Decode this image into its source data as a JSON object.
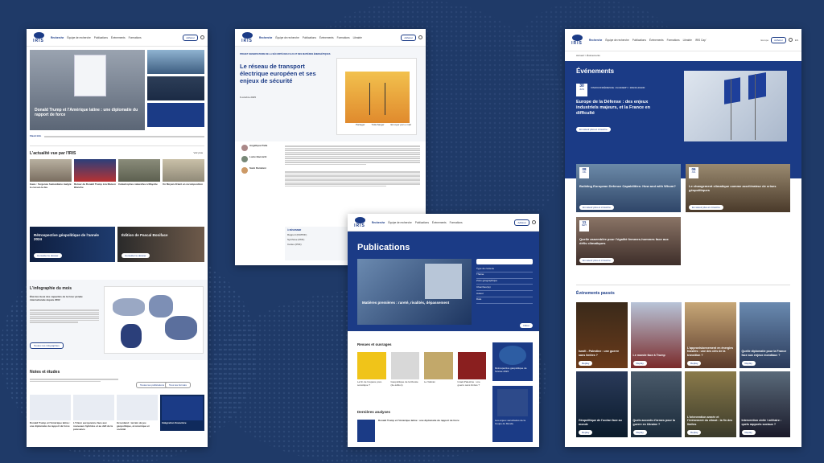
{
  "colors": {
    "background": "#1f3a68",
    "navy": "#1b3b86",
    "dark_card": "#0f2a5c"
  },
  "logo": "IRIS",
  "nav": {
    "recherche": "Recherche",
    "equipe": "Équipe de recherche",
    "publications": "Publications",
    "evenements": "Événements",
    "formations": "Formations",
    "librairie": "Librairie",
    "iris_cap": "IRIS Cap'"
  },
  "util": {
    "europe": "Europe",
    "recrutement": "Recrutement",
    "locations": "Locations",
    "contact": "Contact",
    "adherer": "Adhérer",
    "lang": "EN"
  },
  "home": {
    "hero_title": "Donald Trump et l'Amérique latine : une diplomatie du rapport de force",
    "flash_label": "Flash Info",
    "actu_title": "L'actualité vue par l'IRIS",
    "voir_plus": "Voir plus",
    "actu_cards": [
      "Gaza : l'urgence humanitaire malgré le cessez-le-feu",
      "Retour de Donald Trump à la Maison Blanche",
      "Catastrophes naturelles à Mayotte",
      "Un Moyen-Orient en recomposition"
    ],
    "promo1": "Rétrospective géopolitique de l'année 2024",
    "promo2": "Édition de Pascal Boniface",
    "promo_btn": "Consulter le dossier",
    "infog_title": "L'infographie du mois",
    "infog_sub": "État des lieux des capacités de la Cour pénale internationale depuis 2002",
    "infog_btn": "Toutes nos infographies",
    "notes_title": "Notes et études",
    "notes_btn1": "Toutes les publications",
    "notes_btn2": "Tous les formats",
    "notes_cards": [
      "Donald Trump et l'Amérique latine : une diplomatie du rapport de force",
      "L'Union européenne face aux nouveaux hybrides et au défi de la puissance",
      "Groenland : terrain de jeu géopolitique, économique et sociétal",
      "Intégration financière"
    ]
  },
  "article": {
    "breadcrumb": "PROJET OBSERVATOIRE DE LA SÉCURITÉ DES FLUX ET DES MATIÈRES ÉNERGÉTIQUES",
    "title": "Le réseau de transport électrique européen et ses enjeux de sécurité",
    "date": "6 octobre 2025",
    "authors": [
      "Angélique Palle",
      "Lucie Baccariti",
      "Sami Ramdani"
    ],
    "tools": [
      "Partager",
      "Télécharger",
      "Envoyer par e-mail"
    ],
    "ressources_title": "À RÉSONNER",
    "ressources": [
      "Rapport (FR/PDF)",
      "Synthèse (PDF)",
      "Cartes (PDF)"
    ]
  },
  "publications": {
    "title": "Publications",
    "feature": "Matières premières : rareté, rivalités, dépassement",
    "filter_label": "Filtrer",
    "filters": [
      "Type de contenu",
      "Thème",
      "Zone géographique",
      "Chercheur(e)",
      "Auteur",
      "Date",
      "Ouvrage"
    ],
    "revues_title": "Revues et ouvrages",
    "revues": [
      "La fin de l'espace post-soviétique ?",
      "Géopolitique de la Russie (2e édition)",
      "Le Vatican",
      "Israël-Palestine : une guerre sans limites ?"
    ],
    "side_card": "Rétrospective géopolitique de l'année 2024",
    "analyses_title": "Dernières analyses",
    "analyse": "Donald Trump et l'Amérique latine : une diplomatie du rapport de force",
    "side_card2": "Les enjeux sécuritaires de la Coupe du Monde"
  },
  "events": {
    "breadcrumb": "Accueil > Événements",
    "title": "Événements",
    "date_day": "30",
    "date_month": "JUIN",
    "meta": "VISIOCONFÉRENCE / ACADEMY / 18H30-20H30",
    "feature": "Europe de la Défense : des enjeux industriels majeurs, et la France en difficulté",
    "btn": "En savoir plus et s'inscrire",
    "cards": [
      {
        "day": "08",
        "month": "JUIL",
        "title": "Building European Defence Capabilities: How and with Whom?"
      },
      {
        "day": "06",
        "month": "JUIL",
        "title": "Le changement climatique comme accélérateur de crises géopolitiques"
      },
      {
        "day": "11",
        "month": "SEPT",
        "title": "Quelle assemblée pour l'égalité femmes-hommes face aux défis climatiques"
      }
    ],
    "past_title": "Événements passés",
    "past": [
      "Israël - Palestine : une guerre sans limites ?",
      "Le monde face à Trump",
      "L'approvisionnement en énergies fossiles : une des clés de la transition ?",
      "Quelle diplomatie pour la France face aux enjeux mondiaux ?",
      "Géopolitique de l'océan face au monde",
      "Quels accords d'armes pour la guerre en Ukraine ?",
      "L'intervention armée et l'événement du climat : la fin des limites",
      "Intervention civile / militaire : quels rapports sociaux ?"
    ],
    "past_btn": "Replay"
  }
}
